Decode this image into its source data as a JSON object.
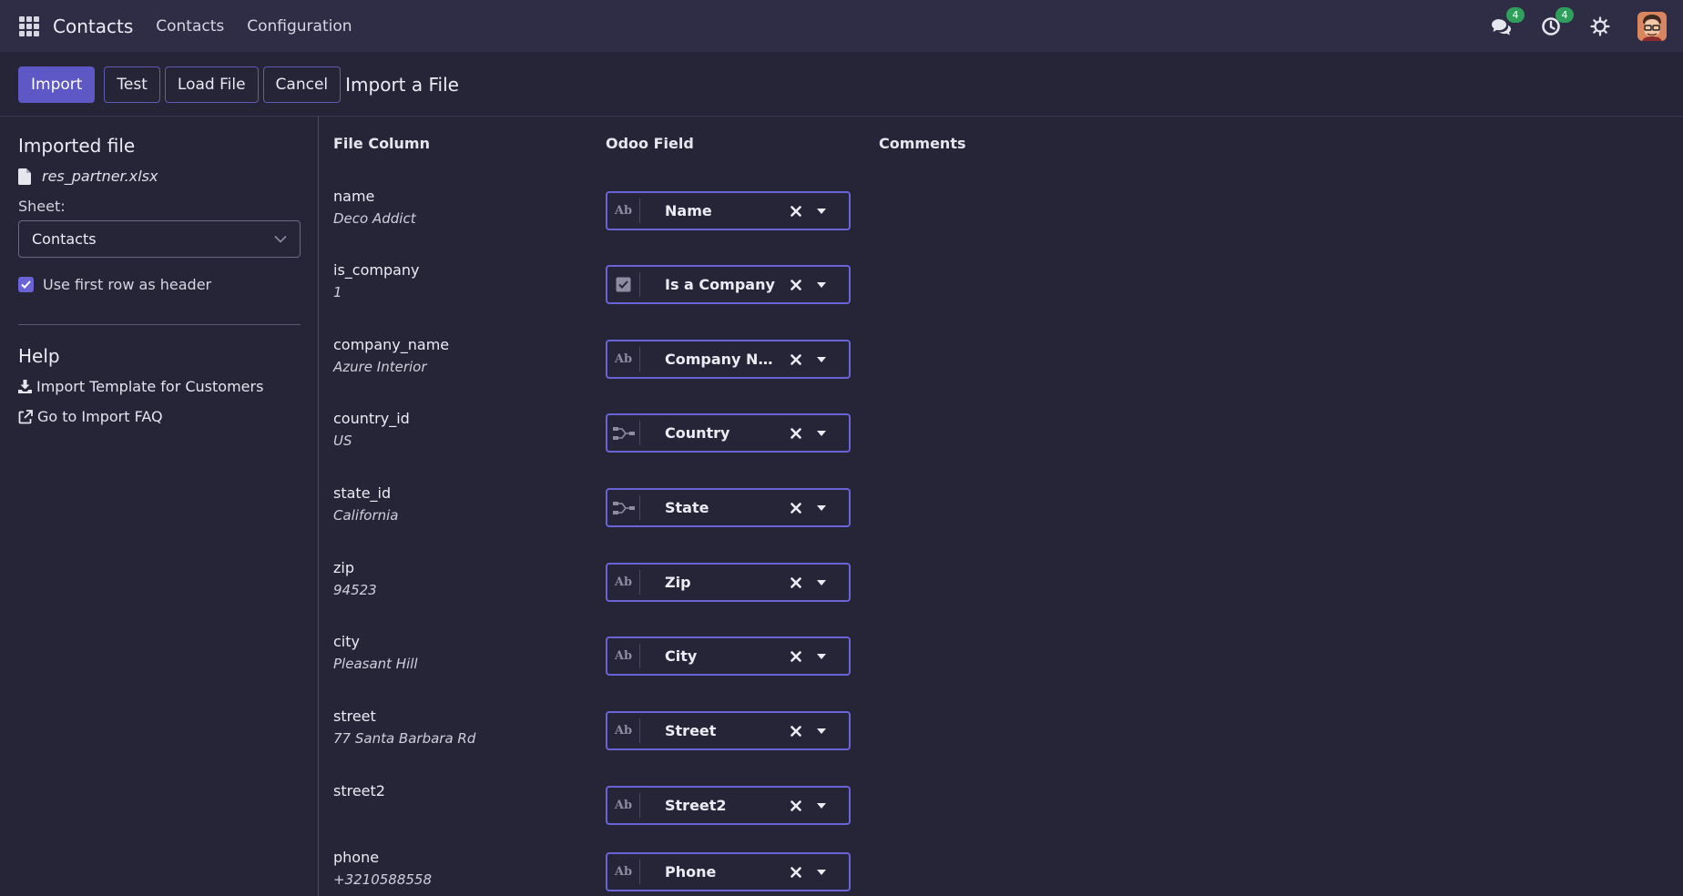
{
  "navbar": {
    "brand": "Contacts",
    "menu": [
      "Contacts",
      "Configuration"
    ],
    "messages_badge": "4",
    "activities_badge": "4"
  },
  "control_panel": {
    "import_label": "Import",
    "test_label": "Test",
    "load_file_label": "Load File",
    "cancel_label": "Cancel",
    "title": "Import a File"
  },
  "sidebar": {
    "imported_file_title": "Imported file",
    "file_name": "res_partner.xlsx",
    "sheet_label": "Sheet:",
    "sheet_value": "Contacts",
    "first_row_header_label": "Use first row as header",
    "first_row_header_checked": true,
    "help_title": "Help",
    "import_template_label": "Import Template for Customers",
    "import_faq_label": "Go to Import FAQ"
  },
  "table": {
    "headers": {
      "file_column": "File Column",
      "odoo_field": "Odoo Field",
      "comments": "Comments"
    },
    "rows": [
      {
        "column": "name",
        "sample": "Deco Addict",
        "field": "Name",
        "type_icon": "text-type-icon",
        "type_text": "Ab"
      },
      {
        "column": "is_company",
        "sample": "1",
        "field": "Is a Company",
        "type_icon": "boolean-type-icon",
        "type_text": ""
      },
      {
        "column": "company_name",
        "sample": "Azure Interior",
        "field": "Company Name",
        "type_icon": "text-type-icon",
        "type_text": "Ab"
      },
      {
        "column": "country_id",
        "sample": "US",
        "field": "Country",
        "type_icon": "relation-type-icon",
        "type_text": ""
      },
      {
        "column": "state_id",
        "sample": "California",
        "field": "State",
        "type_icon": "relation-type-icon",
        "type_text": ""
      },
      {
        "column": "zip",
        "sample": "94523",
        "field": "Zip",
        "type_icon": "text-type-icon",
        "type_text": "Ab"
      },
      {
        "column": "city",
        "sample": "Pleasant Hill",
        "field": "City",
        "type_icon": "text-type-icon",
        "type_text": "Ab"
      },
      {
        "column": "street",
        "sample": "77 Santa Barbara Rd",
        "field": "Street",
        "type_icon": "text-type-icon",
        "type_text": "Ab"
      },
      {
        "column": "street2",
        "sample": "",
        "field": "Street2",
        "type_icon": "text-type-icon",
        "type_text": "Ab"
      },
      {
        "column": "phone",
        "sample": "+3210588558",
        "field": "Phone",
        "type_icon": "text-type-icon",
        "type_text": "Ab"
      }
    ]
  }
}
